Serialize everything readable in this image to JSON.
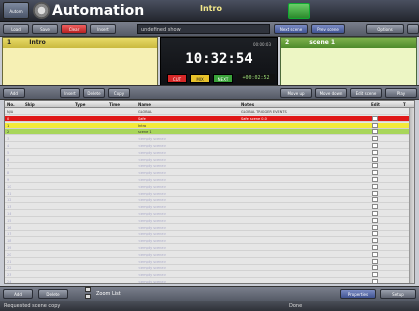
{
  "app": {
    "logo_text": "Autom",
    "title": "Automation",
    "mode_label": "Intro",
    "show_name": "undefined show"
  },
  "toolbar": {
    "buttons": [
      "Load",
      "Save",
      "Clear",
      "Insert"
    ],
    "right_buttons": [
      "Next scene",
      "Prev scene",
      "Options"
    ]
  },
  "panels": {
    "left": {
      "number": "1",
      "name": "Intro"
    },
    "right": {
      "number": "2",
      "name": "scene 1"
    }
  },
  "clock": {
    "label": "00:00:03",
    "time": "10:32:54",
    "buttons": [
      "CUT",
      "MIX",
      "NEXT"
    ],
    "remaining": "+00:02:52"
  },
  "row_toolbar": {
    "left_buttons": [
      "Add",
      "Insert",
      "Delete",
      "Copy"
    ],
    "right_buttons": [
      "Move up",
      "Move down",
      "Edit scene",
      "Play"
    ]
  },
  "table": {
    "columns": [
      "No.",
      "Skip",
      "Type",
      "Time",
      "Name",
      "Notes",
      "Edit",
      "T"
    ],
    "rows": [
      {
        "no": "N/A",
        "name": "GLOBAL",
        "notes": "GLOBAL TRIGGER EVENTS",
        "style": "normal"
      },
      {
        "no": "0",
        "name": "Safe",
        "notes": "Safe scene 0.0",
        "style": "red"
      },
      {
        "no": "1",
        "name": "Intro",
        "notes": "",
        "style": "yellow"
      },
      {
        "no": "2",
        "name": "scene 1",
        "notes": "",
        "style": "green"
      },
      {
        "no": "3",
        "name": "<empty scene>",
        "notes": "",
        "style": "empty"
      },
      {
        "no": "4",
        "name": "<empty scene>",
        "notes": "",
        "style": "empty"
      },
      {
        "no": "5",
        "name": "<empty scene>",
        "notes": "",
        "style": "empty"
      },
      {
        "no": "6",
        "name": "<empty scene>",
        "notes": "",
        "style": "empty"
      },
      {
        "no": "7",
        "name": "<empty scene>",
        "notes": "",
        "style": "empty"
      },
      {
        "no": "8",
        "name": "<empty scene>",
        "notes": "",
        "style": "empty"
      },
      {
        "no": "9",
        "name": "<empty scene>",
        "notes": "",
        "style": "empty"
      },
      {
        "no": "10",
        "name": "<empty scene>",
        "notes": "",
        "style": "empty"
      },
      {
        "no": "11",
        "name": "<empty scene>",
        "notes": "",
        "style": "empty"
      },
      {
        "no": "12",
        "name": "<empty scene>",
        "notes": "",
        "style": "empty"
      },
      {
        "no": "13",
        "name": "<empty scene>",
        "notes": "",
        "style": "empty"
      },
      {
        "no": "14",
        "name": "<empty scene>",
        "notes": "",
        "style": "empty"
      },
      {
        "no": "15",
        "name": "<empty scene>",
        "notes": "",
        "style": "empty"
      },
      {
        "no": "16",
        "name": "<empty scene>",
        "notes": "",
        "style": "empty"
      },
      {
        "no": "17",
        "name": "<empty scene>",
        "notes": "",
        "style": "empty"
      },
      {
        "no": "18",
        "name": "<empty scene>",
        "notes": "",
        "style": "empty"
      },
      {
        "no": "19",
        "name": "<empty scene>",
        "notes": "",
        "style": "empty"
      },
      {
        "no": "20",
        "name": "<empty scene>",
        "notes": "",
        "style": "empty"
      },
      {
        "no": "21",
        "name": "<empty scene>",
        "notes": "",
        "style": "empty"
      },
      {
        "no": "22",
        "name": "<empty scene>",
        "notes": "",
        "style": "empty"
      },
      {
        "no": "23",
        "name": "<empty scene>",
        "notes": "",
        "style": "empty"
      },
      {
        "no": "24",
        "name": "<empty scene>",
        "notes": "",
        "style": "empty"
      }
    ]
  },
  "bottom": {
    "left_buttons": [
      "Add",
      "Delete"
    ],
    "zoom_label": "Zoom List",
    "right_buttons": [
      "Properties",
      "Setup"
    ]
  },
  "status": {
    "message": "Requested scene copy",
    "state": "Done"
  },
  "colors": {
    "red_row": "#e01818",
    "yellow_row": "#f3ea3a",
    "green_row": "#a8d65a",
    "empty_text": "#a9a9c9"
  }
}
